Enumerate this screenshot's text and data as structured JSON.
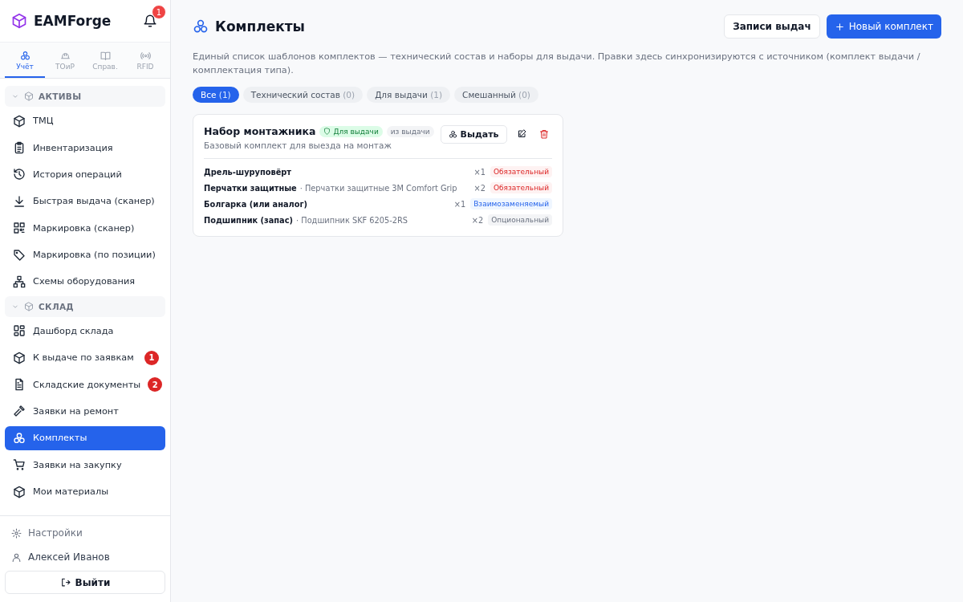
{
  "app": {
    "name": "EAMForge",
    "notifications": "1"
  },
  "module_tabs": [
    {
      "label": "Учёт",
      "selected": true
    },
    {
      "label": "ТОиР",
      "selected": false
    },
    {
      "label": "Справ.",
      "selected": false
    },
    {
      "label": "RFID",
      "selected": false
    }
  ],
  "sidebar": {
    "sections": [
      {
        "title": "АКТИВЫ",
        "expanded": true,
        "items": [
          {
            "label": "ТМЦ",
            "selected": false
          },
          {
            "label": "Инвентаризация",
            "selected": false
          },
          {
            "label": "История операций",
            "selected": false
          },
          {
            "label": "Быстрая выдача (сканер)",
            "selected": false
          },
          {
            "label": "Маркировка (сканер)",
            "selected": false
          },
          {
            "label": "Маркировка (по позиции)",
            "selected": false
          },
          {
            "label": "Схемы оборудования",
            "selected": false
          }
        ]
      },
      {
        "title": "СКЛАД",
        "expanded": true,
        "items": [
          {
            "label": "Дашборд склада",
            "selected": false
          },
          {
            "label": "К выдаче по заявкам",
            "selected": false,
            "badge": "1"
          },
          {
            "label": "Складские документы",
            "selected": false,
            "badge": "2"
          },
          {
            "label": "Заявки на ремонт",
            "selected": false
          },
          {
            "label": "Комплекты",
            "selected": true
          },
          {
            "label": "Заявки на закупку",
            "selected": false
          },
          {
            "label": "Мои материалы",
            "selected": false
          }
        ]
      }
    ],
    "settings": "Настройки",
    "user": "Алексей Иванов",
    "logout": "Выйти"
  },
  "page": {
    "title": "Комплекты",
    "actions": {
      "secondary": "Записи выдач",
      "primary": "Новый комплект"
    },
    "description": "Единый список шаблонов комплектов — технический состав и наборы для выдачи. Правки здесь синхронизируются с источником (комплект выдачи / комплектация типа).",
    "filters": [
      {
        "label": "Все",
        "count": "(1)",
        "selected": true
      },
      {
        "label": "Технический состав",
        "count": "(0)",
        "selected": false
      },
      {
        "label": "Для выдачи",
        "count": "(1)",
        "selected": false
      },
      {
        "label": "Смешанный",
        "count": "(0)",
        "selected": false
      }
    ],
    "kits": [
      {
        "name": "Набор монтажника",
        "type_tag": "Для выдачи",
        "source_tag": "из выдачи",
        "description": "Базовый комплект для выезда на монтаж",
        "issue_button": "Выдать",
        "items": [
          {
            "name": "Дрель-шуруповёрт",
            "qty": "×1",
            "tag": "Обязательный",
            "kind": "required"
          },
          {
            "name": "Перчатки защитные",
            "detail": "· Перчатки защитные 3M Comfort Grip",
            "qty": "×2",
            "tag": "Обязательный",
            "kind": "required"
          },
          {
            "name": "Болгарка (или аналог)",
            "qty": "×1",
            "tag": "Взаимозаменяемый",
            "kind": "interchangeable"
          },
          {
            "name": "Подшипник (запас)",
            "detail": "· Подшипник SKF 6205-2RS",
            "qty": "×2",
            "tag": "Опциональный",
            "kind": "optional"
          }
        ]
      }
    ]
  }
}
